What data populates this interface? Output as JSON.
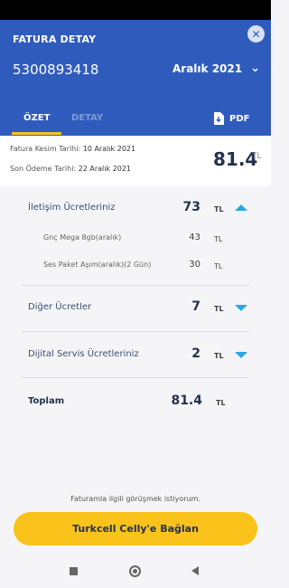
{
  "header": {
    "title": "FATURA DETAY",
    "close_icon": "close-icon",
    "account_number": "5300893418",
    "period": "Aralık 2021",
    "period_icon": "chevron-down-icon"
  },
  "tabs": [
    {
      "label": "ÖZET",
      "active": true
    },
    {
      "label": "DETAY",
      "active": false
    }
  ],
  "pdf": {
    "label": "PDF",
    "icon": "pdf-download-icon"
  },
  "summary": {
    "issue_label": "Fatura Kesim Tarihi:",
    "issue_date": "10 Aralık 2021",
    "due_label": "Son Ödeme Tarihi:",
    "due_date": "22 Aralık 2021",
    "total": "81.4",
    "unit": "TL"
  },
  "charges": {
    "communication": {
      "label": "İletişim Ücretleriniz",
      "value": "73",
      "unit": "TL",
      "expanded": true,
      "items": [
        {
          "label": "Gnç Mega 8gb(aralık)",
          "value": "43",
          "unit": "TL"
        },
        {
          "label": "Ses Paket Aşım(aralık)(2 Gün)",
          "value": "30",
          "unit": "TL"
        }
      ]
    },
    "other": {
      "label": "Diğer Ücretler",
      "value": "7",
      "unit": "TL",
      "expanded": false
    },
    "digital": {
      "label": "Dijital Servis Ücretleriniz",
      "value": "2",
      "unit": "TL",
      "expanded": false
    },
    "total": {
      "label": "Toplam",
      "value": "81.4",
      "unit": "TL"
    }
  },
  "footer": {
    "note": "Faturamla ilgili görüşmek istiyorum.",
    "cta_label": "Turkcell Celly'e Bağlan"
  },
  "colors": {
    "header_blue": "#2f5cbc",
    "accent_yellow": "#f9c31b",
    "arrow_blue": "#2aa7e3"
  }
}
